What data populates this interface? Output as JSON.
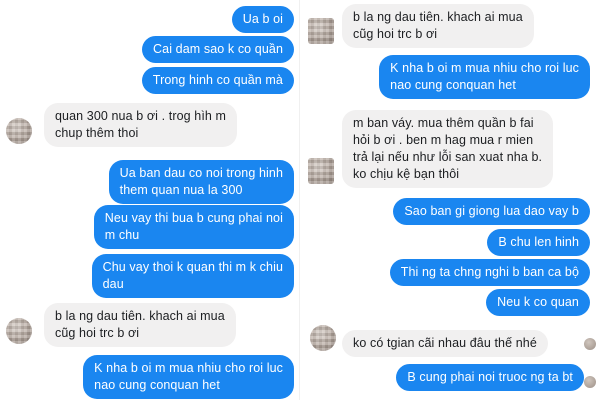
{
  "left_panel": {
    "messages": [
      {
        "side": "out",
        "text": "Ua b oi"
      },
      {
        "side": "out",
        "text": "Cai dam sao k co quần"
      },
      {
        "side": "out",
        "text": "Trong hinh co quần mà"
      },
      {
        "side": "in",
        "text": "quan 300 nua b ơi . trog hìh m\nchup thêm thoi"
      },
      {
        "side": "out",
        "text": "Ua ban dau co noi trong hinh\nthem quan nua la 300"
      },
      {
        "side": "out",
        "text": "Neu vay thi bua b cung phai noi\nm chu"
      },
      {
        "side": "out",
        "text": "Chu vay thoi k quan thi m k chiu\ndau"
      },
      {
        "side": "in",
        "text": "b la ng dau tiên. khach ai mua\ncũg hoi trc b ơi"
      },
      {
        "side": "out",
        "text": "K nha b oi m mua nhiu cho roi luc\nnao cung conquan het"
      }
    ]
  },
  "right_panel": {
    "messages": [
      {
        "side": "in",
        "text": "b la ng dau tiên. khach ai mua\ncũg hoi trc b ơi"
      },
      {
        "side": "out",
        "text": "K nha b oi m mua nhiu cho roi luc\nnao cung conquan het"
      },
      {
        "side": "in",
        "text": "m ban váy. mua thêm quần b fai\nhỏi b ơi . ben m hag mua r mien\ntrả lại nếu như lỗi san xuat nha b.\nko chịu kệ bạn thôi"
      },
      {
        "side": "out",
        "text": "Sao ban gi giong lua dao vay b"
      },
      {
        "side": "out",
        "text": "B chu len hinh"
      },
      {
        "side": "out",
        "text": "Thi ng ta chng nghi b ban ca bộ"
      },
      {
        "side": "out",
        "text": "Neu k co quan"
      },
      {
        "side": "in",
        "text": "ko có tgian cãi nhau đâu thế nhé"
      },
      {
        "side": "out",
        "text": "B cung phai noi truoc ng ta bt"
      }
    ]
  },
  "colors": {
    "outgoing_bubble": "#1a86f0",
    "incoming_bubble": "#f1f0f0"
  }
}
